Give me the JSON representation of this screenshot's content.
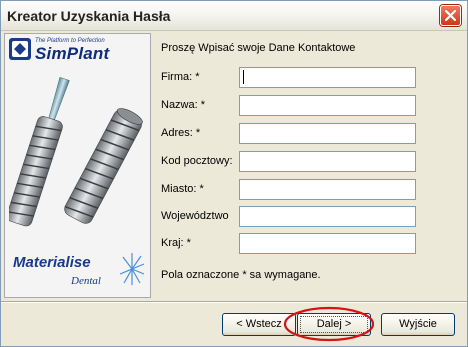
{
  "window": {
    "title": "Kreator Uzyskania Hasła"
  },
  "brand": {
    "tagline": "The Platform to Perfection",
    "name": "SimPlant"
  },
  "footer_logo": {
    "name": "Materialise",
    "sub": "Dental"
  },
  "form": {
    "heading": "Proszę Wpisać swoje Dane Kontaktowe",
    "fields": [
      {
        "label": "Firma: *",
        "value": ""
      },
      {
        "label": "Nazwa: *",
        "value": ""
      },
      {
        "label": "Adres: *",
        "value": ""
      },
      {
        "label": "Kod pocztowy:",
        "value": ""
      },
      {
        "label": "Miasto: *",
        "value": ""
      },
      {
        "label": "Województwo",
        "value": ""
      },
      {
        "label": "Kraj: *",
        "value": ""
      }
    ],
    "required_note": "Pola oznaczone * sa wymagane."
  },
  "buttons": {
    "back": "< Wstecz",
    "next": "Dalej >",
    "exit": "Wyjście"
  },
  "colors": {
    "close_button": "#cc3a18",
    "brand_blue": "#1a3a8a",
    "highlight": "#d21414"
  }
}
